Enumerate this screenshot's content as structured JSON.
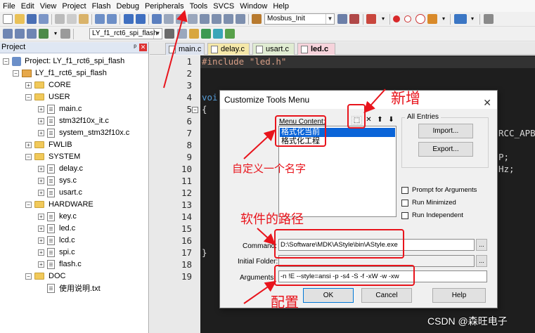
{
  "menu": [
    "File",
    "Edit",
    "View",
    "Project",
    "Flash",
    "Debug",
    "Peripherals",
    "Tools",
    "SVCS",
    "Window",
    "Help"
  ],
  "toolbar": {
    "target_combo": "Mosbus_Init",
    "project_combo": "LY_f1_rct6_spi_flash"
  },
  "project_panel": {
    "title": "Project",
    "root": "Project: LY_f1_rct6_spi_flash",
    "target": "LY_f1_rct6_spi_flash",
    "groups": [
      {
        "name": "CORE",
        "files": []
      },
      {
        "name": "USER",
        "files": [
          "main.c",
          "stm32f10x_it.c",
          "system_stm32f10x.c"
        ]
      },
      {
        "name": "FWLIB",
        "files": []
      },
      {
        "name": "SYSTEM",
        "files": [
          "delay.c",
          "sys.c",
          "usart.c"
        ]
      },
      {
        "name": "HARDWARE",
        "files": [
          "key.c",
          "led.c",
          "lcd.c",
          "spi.c",
          "flash.c"
        ]
      },
      {
        "name": "DOC",
        "files": [
          "使用说明.txt"
        ]
      }
    ]
  },
  "editor": {
    "tabs": [
      "main.c",
      "delay.c",
      "usart.c",
      "led.c"
    ],
    "active_tab": "led.c",
    "line_numbers": [
      "1",
      "2",
      "3",
      "4",
      "5",
      "6",
      "7",
      "8",
      "9",
      "10",
      "11",
      "12",
      "13",
      "14",
      "15",
      "16",
      "17",
      "18",
      "19"
    ],
    "code_line_1": "#include \"led.h\"",
    "code_line_4": "voi",
    "code_line_5": "{",
    "code_line_17": "}",
    "frag_apb": "RCC_APB",
    "frag_p": "P;",
    "frag_hz": "Hz;"
  },
  "dialog": {
    "title": "Customize Tools Menu",
    "menu_content_label": "Menu Content:",
    "menu_items": [
      "格式化当前",
      "格式化工程"
    ],
    "selected_item": "格式化当前",
    "all_entries_label": "All Entries",
    "import_button": "Import...",
    "export_button": "Export...",
    "prompt_for_arguments": "Prompt for Arguments",
    "run_minimized": "Run Minimized",
    "run_independent": "Run Independent",
    "command_label": "Command:",
    "command_value": "D:\\Software\\MDK\\AStyle\\bin\\AStyle.exe",
    "initial_folder_label": "Initial Folder:",
    "initial_folder_value": "",
    "arguments_label": "Arguments:",
    "arguments_value": "-n !E  --style=ansi -p -s4 -S -f -xW -w -xw",
    "browse_label": "...",
    "ok_button": "OK",
    "cancel_button": "Cancel",
    "help_button": "Help"
  },
  "annotations": {
    "new": "新增",
    "custom_name": "自定义一个名字",
    "software_path": "软件的路径",
    "config": "配置",
    "accent_color": "#e8141c"
  },
  "watermark": "CSDN @森旺电子"
}
